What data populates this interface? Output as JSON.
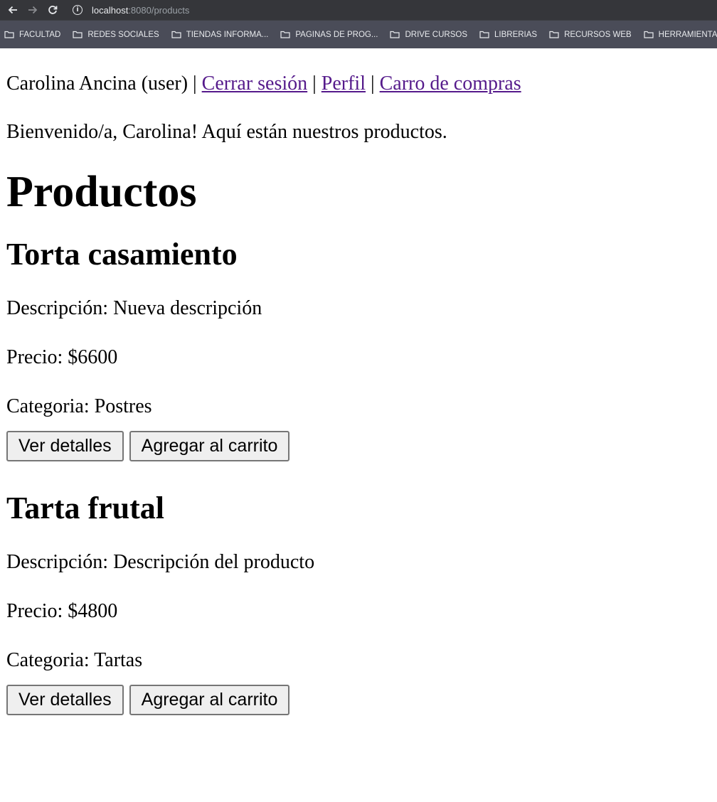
{
  "browser": {
    "url_host": "localhost",
    "url_rest": ":8080/products",
    "bookmarks": [
      {
        "label": "FACULTAD",
        "icon": "folder-icon"
      },
      {
        "label": "REDES SOCIALES",
        "icon": "folder-icon"
      },
      {
        "label": "TIENDAS INFORMA...",
        "icon": "folder-icon"
      },
      {
        "label": "PAGINAS DE PROG...",
        "icon": "folder-icon"
      },
      {
        "label": "DRIVE CURSOS",
        "icon": "folder-icon"
      },
      {
        "label": "LIBRERIAS",
        "icon": "folder-icon"
      },
      {
        "label": "RECURSOS WEB",
        "icon": "folder-icon"
      },
      {
        "label": "HERRAMIENTAS",
        "icon": "folder-icon"
      }
    ],
    "nav_icons": [
      "back-arrow-icon",
      "forward-arrow-icon",
      "reload-icon",
      "info-icon"
    ]
  },
  "header": {
    "user_text": "Carolina Ancina (user)",
    "separator": "|",
    "logout": "Cerrar sesión",
    "profile": "Perfil",
    "cart": "Carro de compras"
  },
  "welcome": "Bienvenido/a, Carolina! Aquí están nuestros productos.",
  "title": "Productos",
  "products": [
    {
      "name": "Torta casamiento",
      "description": "Descripción: Nueva descripción",
      "price": "Precio: $6600",
      "category": "Categoria: Postres",
      "details_label": "Ver detalles",
      "add_label": "Agregar al carrito"
    },
    {
      "name": "Tarta frutal",
      "description": "Descripción: Descripción del producto",
      "price": "Precio: $4800",
      "category": "Categoria: Tartas",
      "details_label": "Ver detalles",
      "add_label": "Agregar al carrito"
    }
  ],
  "colors": {
    "link": "#551a8b",
    "chrome_bg": "#35363a",
    "bookmarks_bg": "#4a4c58",
    "button_bg": "#efefef"
  }
}
